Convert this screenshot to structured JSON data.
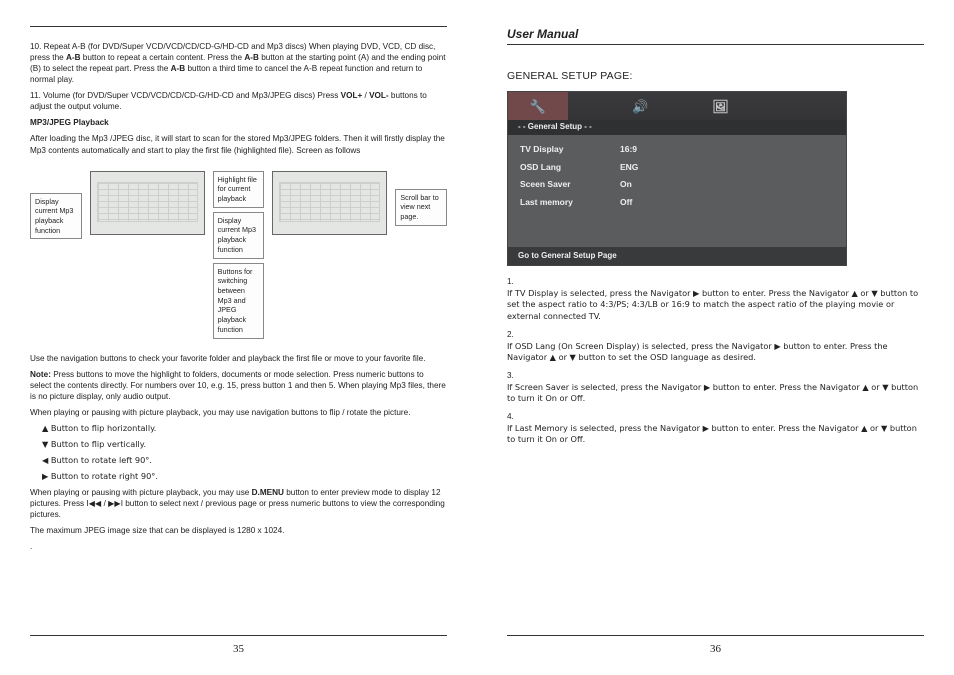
{
  "left": {
    "repeat_ab_label": "10.  Repeat A-B ",
    "repeat_ab_for": "(for DVD/Super VCD/VCD/CD/CD-G/HD-CD and Mp3 discs) When playing DVD, VCD, CD disc, press the ",
    "ab1": "A-B",
    "repeat_ab_mid": " button to repeat a certain content. Press the ",
    "ab2": "A-B",
    "repeat_ab_mid2": " button at the starting point (A) and the ending point (B) to select the repeat part. Press the ",
    "ab3": "A-B",
    "repeat_ab_end": " button a third time to cancel the A-B repeat function and return to normal play.",
    "vol_label": "11. Volume ",
    "vol_for": "(for DVD/Super VCD/VCD/CD/CD-G/HD-CD and Mp3/JPEG discs) Press ",
    "volp": "VOL+",
    "vol_sep": " / ",
    "volm": "VOL-",
    "vol_end": " buttons to adjust the output volume.",
    "mp3_heading": "MP3/JPEG Playback",
    "mp3_intro": "After loading the Mp3 /JPEG disc, it will start to scan for the stored Mp3/JPEG folders. Then it will firstly display the Mp3 contents automatically and start to play the first file (highlighted file). Screen as follows",
    "callouts": {
      "display_current_func": "Display current Mp3 playback function",
      "highlight_file": "Highlight file for current playback",
      "display_current_mp3": "Display current Mp3 playback function",
      "switch_buttons": "Buttons for switching between Mp3 and JPEG playback function",
      "scroll_bar": "Scroll bar to view next page."
    },
    "nav_check": "Use the navigation buttons to check your favorite folder and playback the first file or move to your favorite file.",
    "note_label": "Note:",
    "note_body": " Press buttons to move the highlight to folders, documents or mode selection. Press numeric buttons to select the contents directly. For numbers over 10, e.g. 15, press button 1 and then 5. When playing Mp3 files, there is no picture display, only audio output.",
    "pic_nav_intro": "When playing or pausing with picture playback, you may use navigation buttons to flip / rotate the picture.",
    "btn_up": "▲ Button to flip horizontally.",
    "btn_down": "▼ Button to flip vertically.",
    "btn_left": "◀ Button to rotate left 90°.",
    "btn_right": "▶ Button to rotate right 90°.",
    "preview1": "When playing or pausing with picture playback, you may use ",
    "dmenu": "D.MENU",
    "preview2": " button to enter preview mode to display 12 pictures. Press I◀◀ / ▶▶I button to select next / previous page or press numeric buttons to view the corresponding pictures.",
    "max_jpeg": "The maximum JPEG image size that can be displayed is 1280 x 1024.",
    "dot": ".",
    "pagenum": "35"
  },
  "right": {
    "header": "User Manual",
    "section": "GENERAL SETUP PAGE:",
    "setup": {
      "breadcrumb": "- - General Setup - -",
      "rows": [
        {
          "k": "TV Display",
          "v": "16:9"
        },
        {
          "k": "OSD Lang",
          "v": "ENG"
        },
        {
          "k": "Sceen Saver",
          "v": "On"
        },
        {
          "k": "Last memory",
          "v": "Off"
        }
      ],
      "footer": "Go to General Setup Page"
    },
    "items": [
      {
        "n": "1.",
        "t": "If TV Display is selected, press the Navigator ▶ button to enter. Press the Navigator ▲ or ▼ button to set the aspect ratio to 4:3/PS; 4:3/LB or 16:9 to match the aspect ratio of the playing movie or external connected TV."
      },
      {
        "n": "2.",
        "t": "If OSD Lang (On Screen Display) is selected, press the Navigator ▶ button to enter. Press the Navigator ▲ or ▼ button to set the OSD language as desired."
      },
      {
        "n": "3.",
        "t": "If Screen Saver is selected, press the Navigator ▶ button to enter. Press the Navigator ▲ or ▼ button to turn it On or Off."
      },
      {
        "n": "4.",
        "t": "If Last Memory is selected, press the Navigator ▶ button to enter. Press the Navigator ▲ or ▼ button to turn it On or Off."
      }
    ],
    "pagenum": "36"
  }
}
